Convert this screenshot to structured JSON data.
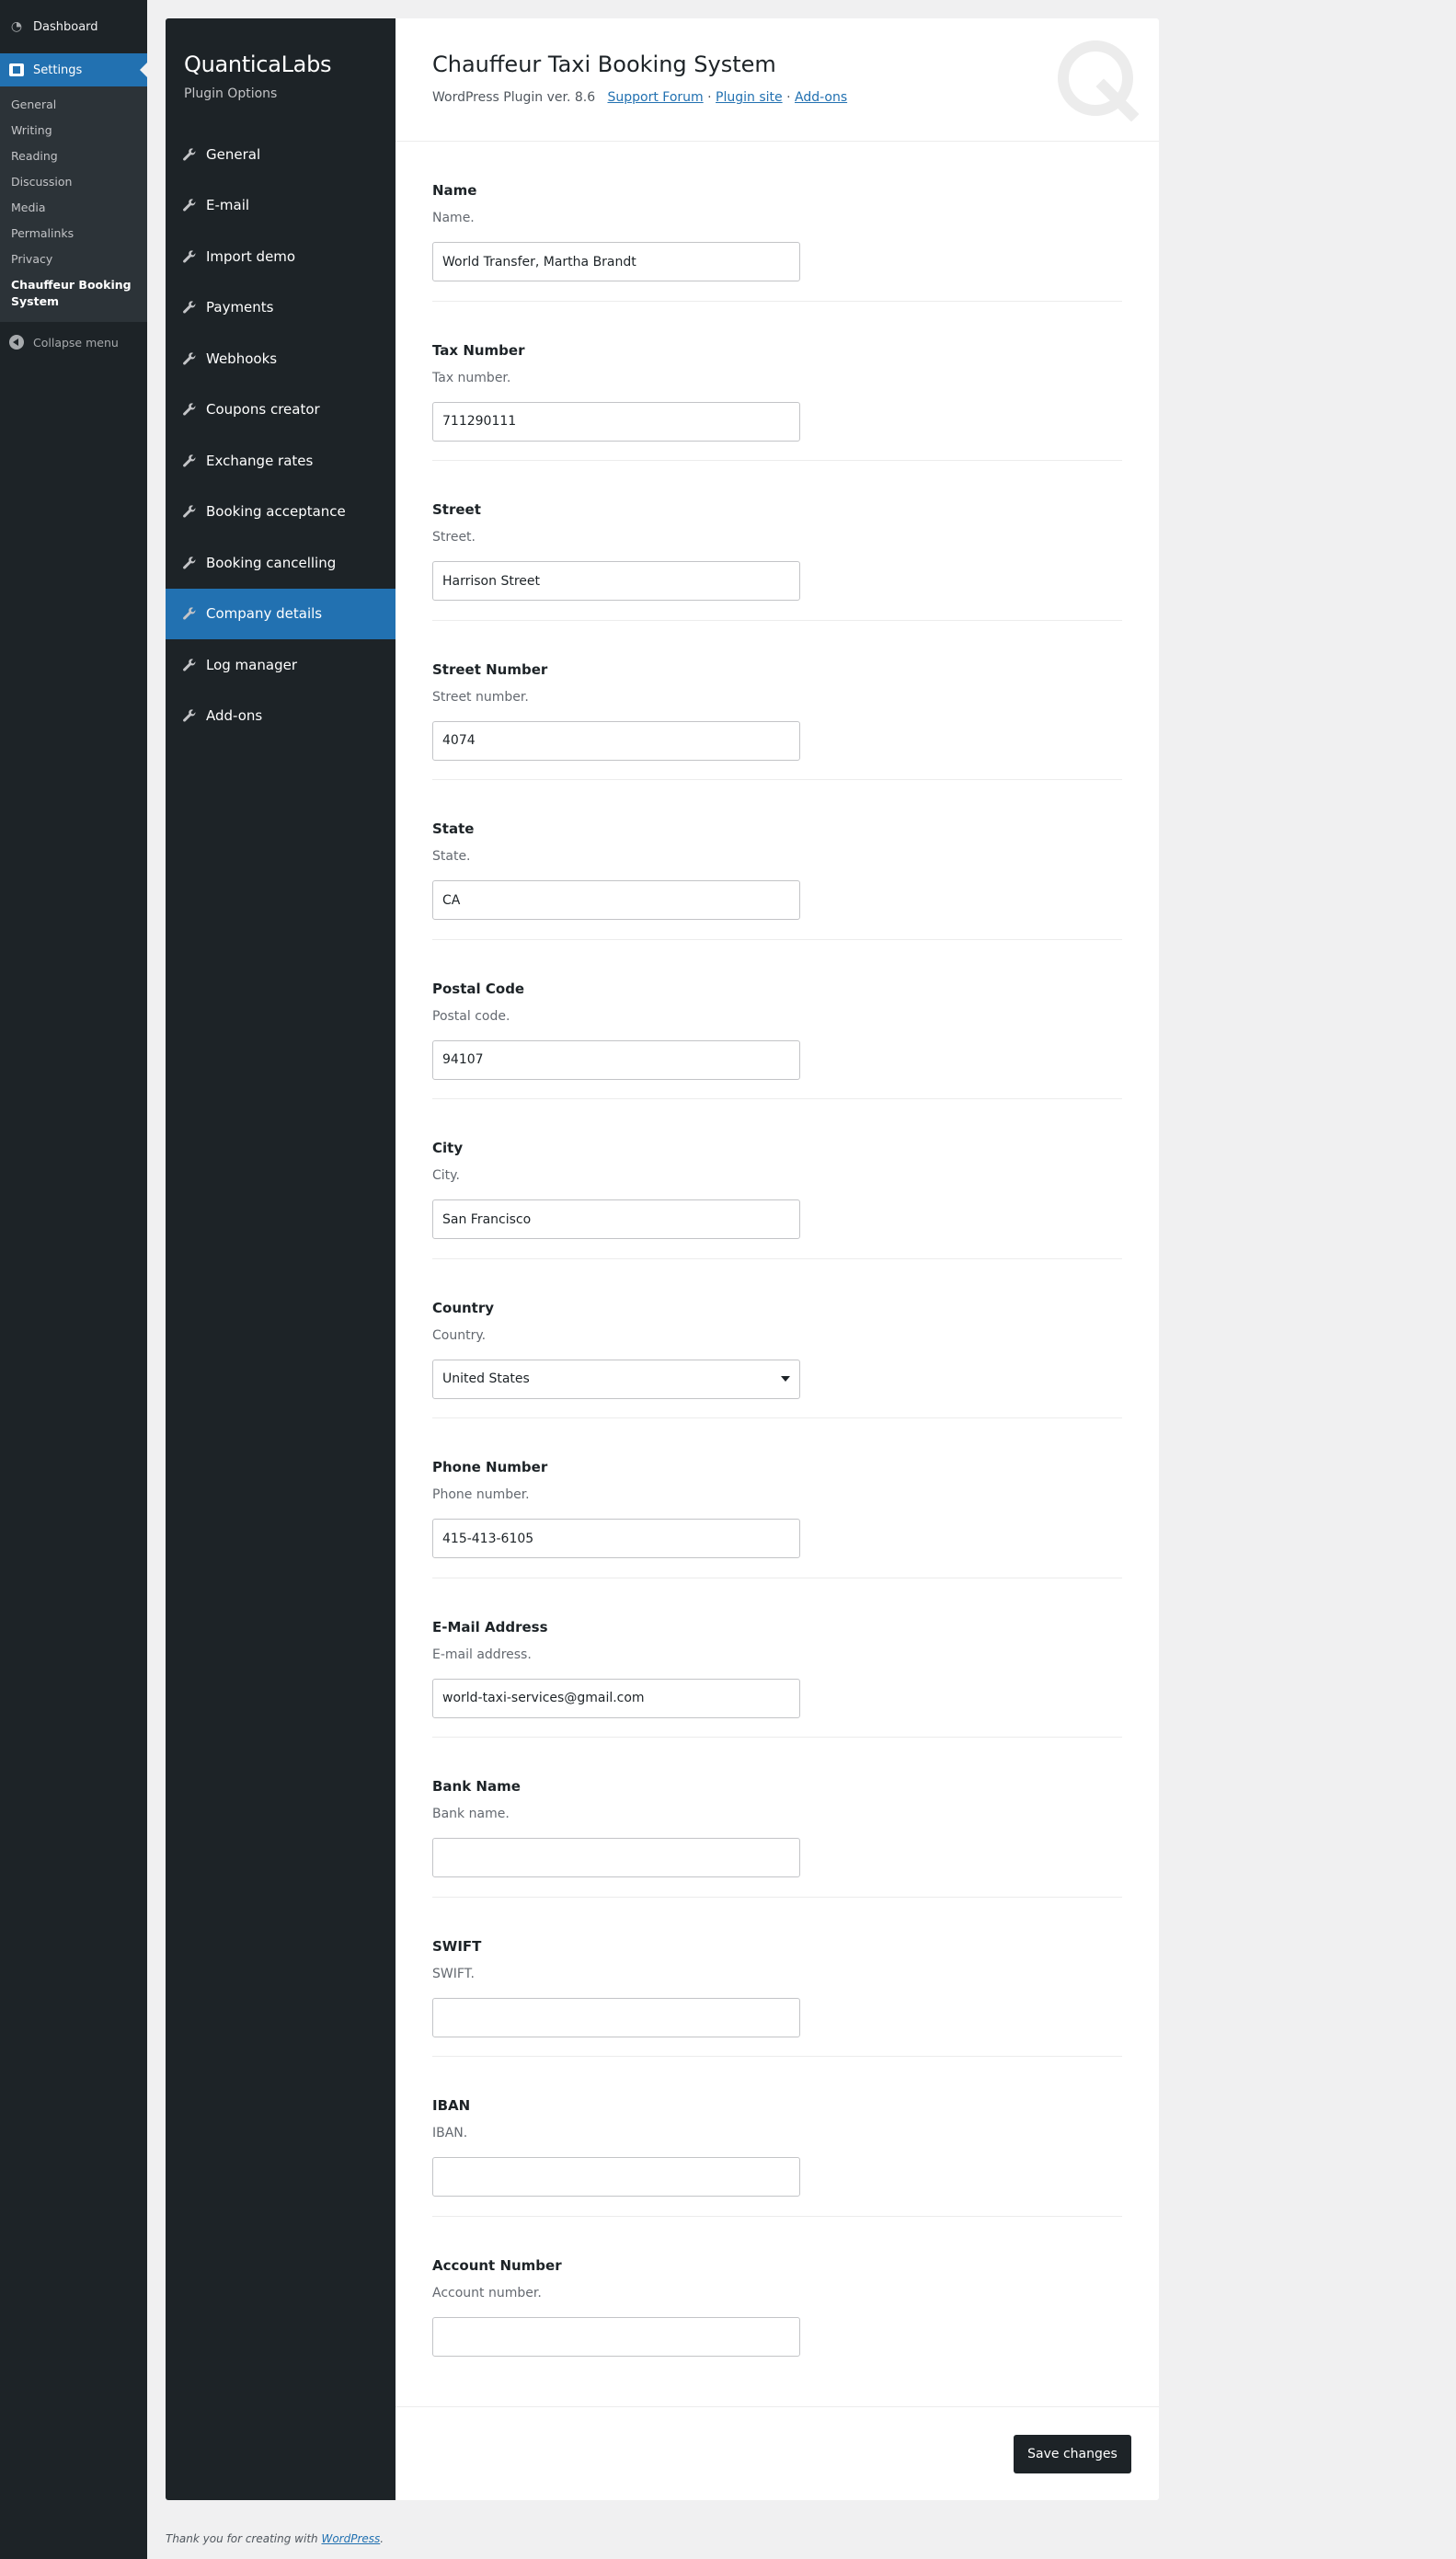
{
  "wp_menu": {
    "dashboard": "Dashboard",
    "settings": "Settings",
    "sub_items": [
      "General",
      "Writing",
      "Reading",
      "Discussion",
      "Media",
      "Permalinks",
      "Privacy"
    ],
    "current_sub": "Chauffeur Booking System",
    "collapse": "Collapse menu"
  },
  "plugin_nav": {
    "brand": "QuanticaLabs",
    "subtitle": "Plugin Options",
    "items": [
      {
        "label": "General"
      },
      {
        "label": "E-mail"
      },
      {
        "label": "Import demo"
      },
      {
        "label": "Payments"
      },
      {
        "label": "Webhooks"
      },
      {
        "label": "Coupons creator"
      },
      {
        "label": "Exchange rates"
      },
      {
        "label": "Booking acceptance"
      },
      {
        "label": "Booking cancelling"
      },
      {
        "label": "Company details"
      },
      {
        "label": "Log manager"
      },
      {
        "label": "Add-ons"
      }
    ],
    "active": "Company details"
  },
  "header": {
    "title": "Chauffeur Taxi Booking System",
    "version": "WordPress Plugin ver. 8.6",
    "links": [
      "Support Forum",
      "Plugin site",
      "Add-ons"
    ],
    "separator": "·"
  },
  "form": {
    "name": {
      "label": "Name",
      "desc": "Name.",
      "value": "World Transfer, Martha Brandt"
    },
    "tax_number": {
      "label": "Tax Number",
      "desc": "Tax number.",
      "value": "711290111"
    },
    "street": {
      "label": "Street",
      "desc": "Street.",
      "value": "Harrison Street"
    },
    "street_number": {
      "label": "Street Number",
      "desc": "Street number.",
      "value": "4074"
    },
    "state": {
      "label": "State",
      "desc": "State.",
      "value": "CA"
    },
    "postal_code": {
      "label": "Postal Code",
      "desc": "Postal code.",
      "value": "94107"
    },
    "city": {
      "label": "City",
      "desc": "City.",
      "value": "San Francisco"
    },
    "country": {
      "label": "Country",
      "desc": "Country.",
      "value": "United States"
    },
    "phone": {
      "label": "Phone Number",
      "desc": "Phone number.",
      "value": "415-413-6105"
    },
    "email": {
      "label": "E-Mail Address",
      "desc": "E-mail address.",
      "value": "world-taxi-services@gmail.com"
    },
    "bank_name": {
      "label": "Bank Name",
      "desc": "Bank name.",
      "value": ""
    },
    "swift": {
      "label": "SWIFT",
      "desc": "SWIFT.",
      "value": ""
    },
    "iban": {
      "label": "IBAN",
      "desc": "IBAN.",
      "value": ""
    },
    "account_number": {
      "label": "Account Number",
      "desc": "Account number.",
      "value": ""
    }
  },
  "actions": {
    "save": "Save changes"
  },
  "footer": {
    "text": "Thank you for creating with",
    "link": "WordPress",
    "end": "."
  }
}
